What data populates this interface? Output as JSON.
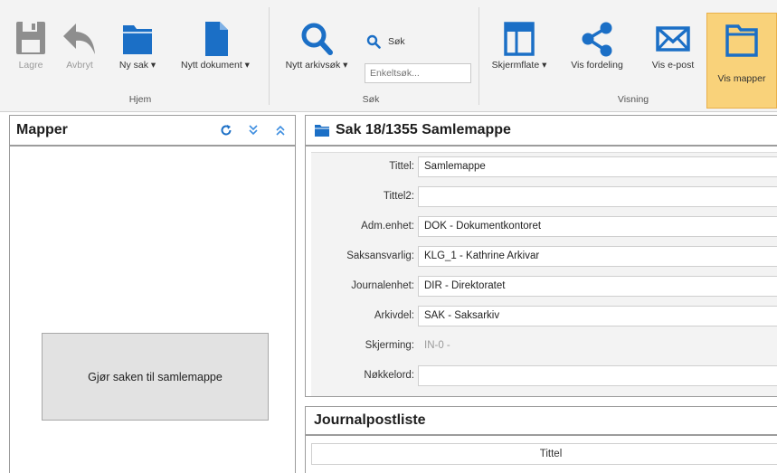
{
  "ribbon": {
    "hjem": {
      "group_label": "Hjem",
      "lagre": "Lagre",
      "avbryt": "Avbryt",
      "ny_sak": "Ny sak ▾",
      "nytt_dokument": "Nytt dokument ▾"
    },
    "sok": {
      "group_label": "Søk",
      "nytt_arkivsok": "Nytt arkivsøk ▾",
      "sok_label": "Søk",
      "enkeltsok_placeholder": "Enkeltsøk..."
    },
    "visning": {
      "group_label": "Visning",
      "skjermflate": "Skjermflate ▾",
      "vis_fordeling": "Vis fordeling",
      "vis_epost": "Vis e-post",
      "vis_mapper": "Vis mapper"
    }
  },
  "mapper_panel": {
    "title": "Mapper",
    "samlemappe_button": "Gjør saken til samlemappe"
  },
  "sak_panel": {
    "title": "Sak 18/1355 Samlemappe",
    "fields": [
      {
        "label": "Tittel:",
        "value": "Samlemappe"
      },
      {
        "label": "Tittel2:",
        "value": ""
      },
      {
        "label": "Adm.enhet:",
        "value": "DOK - Dokumentkontoret"
      },
      {
        "label": "Saksansvarlig:",
        "value": "KLG_1 - Kathrine Arkivar"
      },
      {
        "label": "Journalenhet:",
        "value": "DIR - Direktoratet"
      },
      {
        "label": "Arkivdel:",
        "value": "SAK - Saksarkiv"
      },
      {
        "label": "Skjerming:",
        "value": "IN-0 -"
      },
      {
        "label": "Nøkkelord:",
        "value": ""
      }
    ]
  },
  "journalpost_panel": {
    "title": "Journalpostliste",
    "column_tittel": "Tittel"
  },
  "colors": {
    "accent_blue": "#1b6fc6",
    "disabled_gray": "#8e8e8e",
    "active_highlight": "#f9d27a"
  }
}
